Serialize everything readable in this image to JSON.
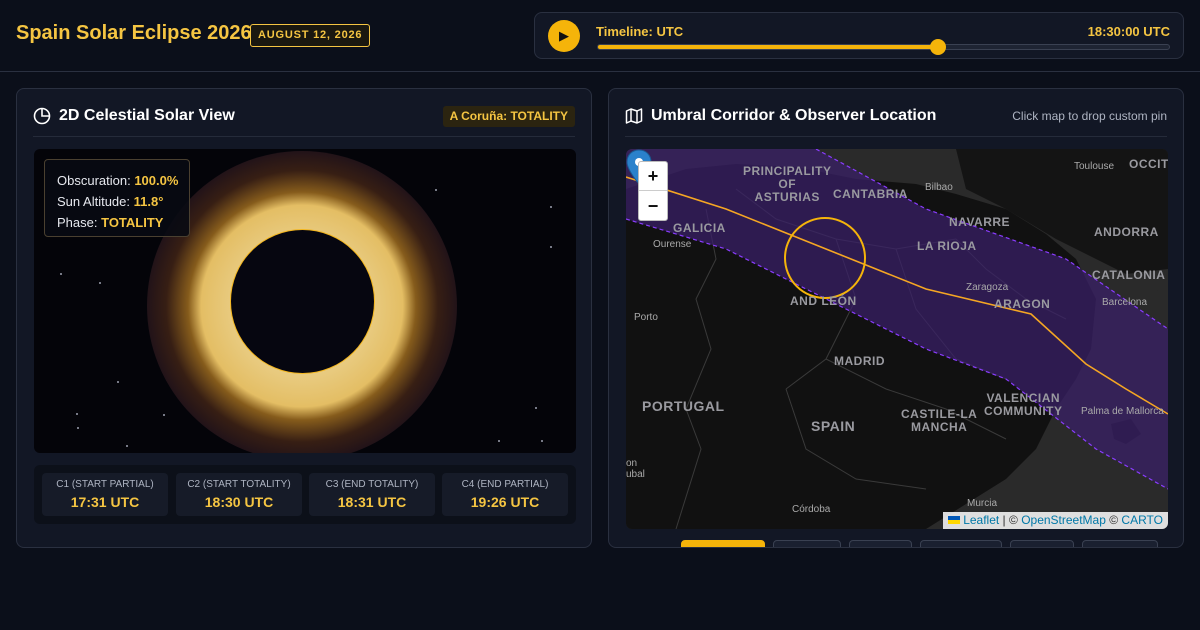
{
  "header": {
    "title": "Spain Solar Eclipse 2026",
    "date_badge": "AUGUST 12, 2026",
    "timeline_label": "Timeline: UTC",
    "timeline_time": "18:30:00 UTC",
    "timeline_progress": 0.595,
    "play_icon": "play-icon",
    "play_glyph": "▶"
  },
  "left_panel": {
    "title": "2D Celestial Solar View",
    "status": "A Coruña: TOTALITY",
    "info": {
      "obscuration_label": "Obscuration:",
      "obscuration_value": "100.0%",
      "altitude_label": "Sun Altitude:",
      "altitude_value": "11.8°",
      "phase_label": "Phase:",
      "phase_value": "TOTALITY"
    },
    "contacts": [
      {
        "label": "C1 (START PARTIAL)",
        "time": "17:31 UTC"
      },
      {
        "label": "C2 (START TOTALITY)",
        "time": "18:30 UTC"
      },
      {
        "label": "C3 (END TOTALITY)",
        "time": "18:31 UTC"
      },
      {
        "label": "C4 (END PARTIAL)",
        "time": "19:26 UTC"
      }
    ]
  },
  "right_panel": {
    "title": "Umbral Corridor & Observer Location",
    "hint": "Click map to drop custom pin",
    "zoom_in": "+",
    "zoom_out": "−",
    "attribution": {
      "leaflet": "Leaflet",
      "sep1": " | © ",
      "osm": "OpenStreetMap",
      "sep2": " © ",
      "carto": "CARTO"
    },
    "labels": {
      "asturias": "PRINCIPALITY\nOF\nASTURIAS",
      "cantabria": "CANTABRIA",
      "bilbao": "Bilbao",
      "toulouse": "Toulouse",
      "occitanie": "OCCITA",
      "galicia": "GALICIA",
      "ourense": "Ourense",
      "navarre": "NAVARRE",
      "andorra": "ANDORRA",
      "la_rioja": "LA RIOJA",
      "castile_leon": "AND LEÓN",
      "zaragoza": "Zaragoza",
      "aragon": "ARAGON",
      "catalonia": "CATALONIA",
      "barcelona": "Barcelona",
      "porto": "Porto",
      "madrid": "MADRID",
      "portugal": "PORTUGAL",
      "spain": "SPAIN",
      "castile_mancha": "CASTILE-LA\nMANCHA",
      "valencian": "VALENCIAN\nCOMMUNITY",
      "palma": "Palma de Mallorca",
      "lisbon": "on\nubal",
      "murcia": "Murcia",
      "cordoba": "Córdoba"
    },
    "colors": {
      "corridor": "#3b1f6b",
      "corridor_edge": "#8a3cff",
      "centerline": "#f5a623",
      "pin": "#2a81cb"
    }
  },
  "colors": {
    "accent": "#f5c542",
    "background": "#0b0f1a",
    "panel": "#121725"
  }
}
